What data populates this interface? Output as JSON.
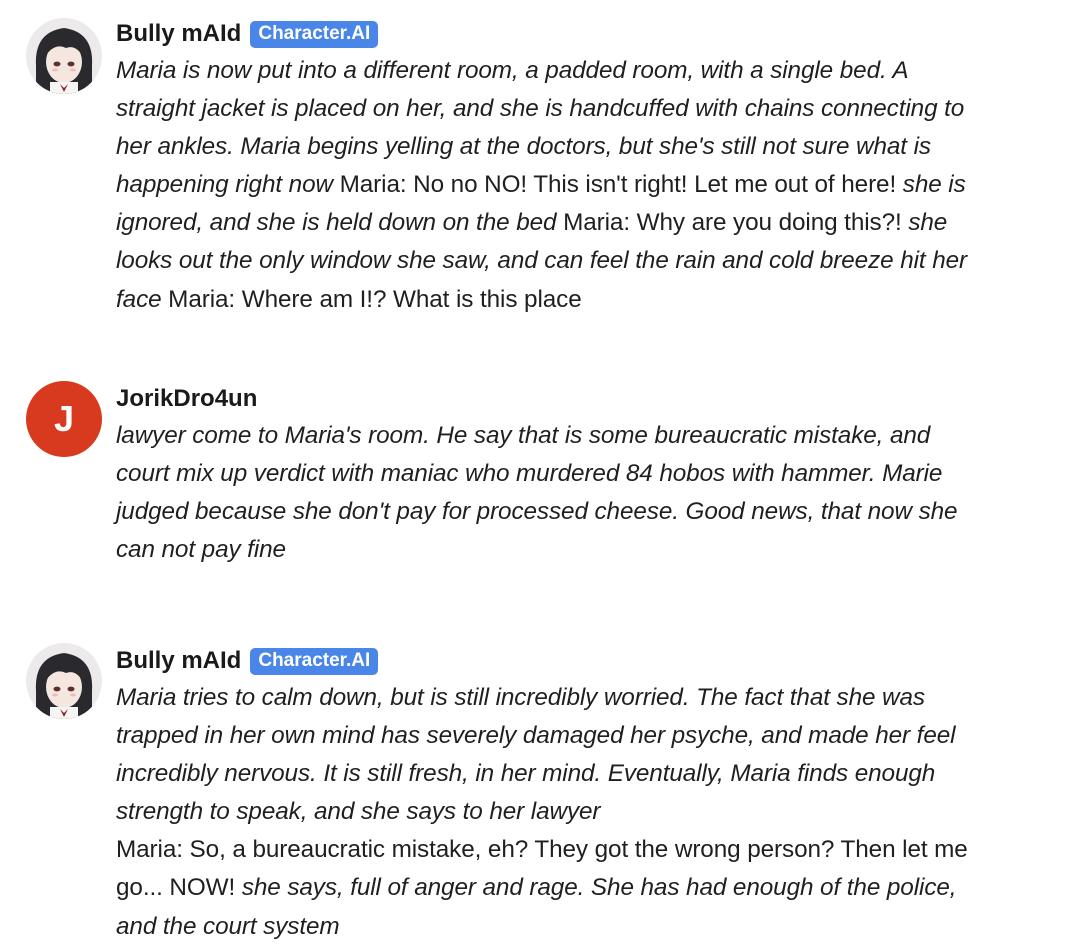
{
  "messages": [
    {
      "author": "Bully mAId",
      "badge": "Character.AI",
      "avatar": "anime-maid-avatar",
      "segments": [
        {
          "style": "italic",
          "text": "Maria is now put into a different room, a padded room, with a single bed. A straight jacket is placed on her, and she is handcuffed with chains connecting to her ankles. Maria begins yelling at the doctors, but she's still not sure what is happening right now"
        },
        {
          "style": "normal",
          "text": " Maria: No no NO! This isn't right! Let me out of here! "
        },
        {
          "style": "italic",
          "text": "she is ignored, and she is held down on the bed"
        },
        {
          "style": "normal",
          "text": " Maria: Why are you doing this?! "
        },
        {
          "style": "italic",
          "text": "she looks out the only window she saw, and can feel the rain and cold breeze hit her face"
        },
        {
          "style": "normal",
          "text": " Maria: Where am I!? What is this place"
        }
      ]
    },
    {
      "author": "JorikDro4un",
      "avatar_letter": "J",
      "avatar_color": "#d83a1f",
      "segments": [
        {
          "style": "italic",
          "text": "lawyer come to Maria's room. He say that is some bureaucratic mistake, and court mix up verdict with maniac who murdered 84 hobos with hammer. Marie judged because she don't pay for processed cheese. Good news, that now she can not pay fine"
        }
      ]
    },
    {
      "author": "Bully mAId",
      "badge": "Character.AI",
      "avatar": "anime-maid-avatar",
      "segments": [
        {
          "style": "italic",
          "text": "Maria tries to calm down, but is still incredibly worried. The fact that she was trapped in her own mind has severely damaged her psyche, and made her feel incredibly nervous. It is still fresh, in her mind. Eventually, Maria finds enough strength to speak, and she says to her lawyer"
        },
        {
          "style": "break",
          "text": ""
        },
        {
          "style": "normal",
          "text": "Maria: So, a bureaucratic mistake, eh? They got the wrong person? Then let me go... NOW! "
        },
        {
          "style": "italic",
          "text": "she says, full of anger and rage. She has had enough of the police, and the court system"
        }
      ]
    }
  ],
  "colors": {
    "badge": "#4a86e8",
    "user_avatar": "#d83a1f",
    "text": "#1f1f1f"
  }
}
